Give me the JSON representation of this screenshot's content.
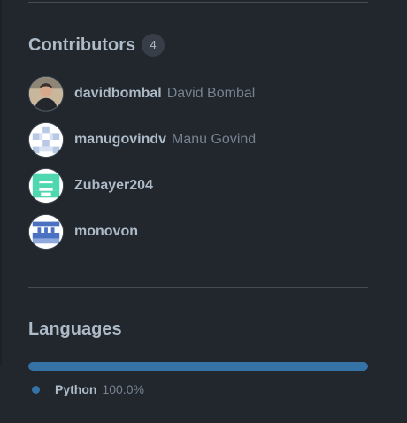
{
  "contributors": {
    "title": "Contributors",
    "count": "4",
    "items": [
      {
        "login": "davidbombal",
        "name": "David Bombal",
        "avatar": "photo-avatar"
      },
      {
        "login": "manugovindv",
        "name": "Manu Govind",
        "avatar": "identicon-avatar"
      },
      {
        "login": "Zubayer204",
        "name": "",
        "avatar": "identicon-avatar"
      },
      {
        "login": "monovon",
        "name": "",
        "avatar": "identicon-avatar"
      }
    ]
  },
  "languages": {
    "title": "Languages",
    "items": [
      {
        "name": "Python",
        "percent_text": "100.0%",
        "percent": 100,
        "color": "#3572A5"
      }
    ]
  },
  "colors": {
    "background": "#22272e",
    "text_primary": "#adbac7",
    "text_muted": "#768390",
    "divider": "#444c56",
    "python": "#3572A5",
    "identicon_blue_light": "#b8c9e6",
    "identicon_teal": "#4fd8b0",
    "identicon_blue": "#4b72c2"
  }
}
